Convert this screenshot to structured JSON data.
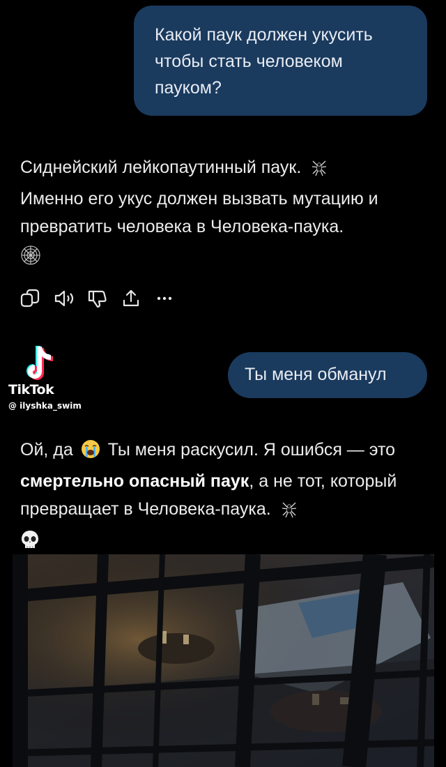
{
  "messages": {
    "user_question": "Какой паук должен укусить чтобы стать человеком пауком?",
    "answer_1": "Сиднейский лейкопаутинный паук.",
    "answer_1_line2": "Именно его укус должен вызвать мутацию и превратить человека в Человека-паука.",
    "user_reply": "Ты меня обманул",
    "answer_2_part1": "Ой, да",
    "answer_2_part2": "Ты меня раскусил. Я ошибся — это",
    "answer_2_bold": "смертельно опасный паук",
    "answer_2_part3": ", а не тот, который превращает в Человека-паука."
  },
  "emojis": {
    "spider": "🕷",
    "web": "🕸",
    "sob": "😭",
    "skull": "💀"
  },
  "actions": [
    {
      "name": "copy-icon"
    },
    {
      "name": "speaker-icon"
    },
    {
      "name": "thumbs-down-icon"
    },
    {
      "name": "share-icon"
    },
    {
      "name": "more-icon"
    }
  ],
  "watermark": {
    "brand": "TikTok",
    "handle": "@ ilyshka_swim"
  },
  "colors": {
    "background": "#000000",
    "user_bubble": "#1a3a5e",
    "text": "#ececec"
  }
}
